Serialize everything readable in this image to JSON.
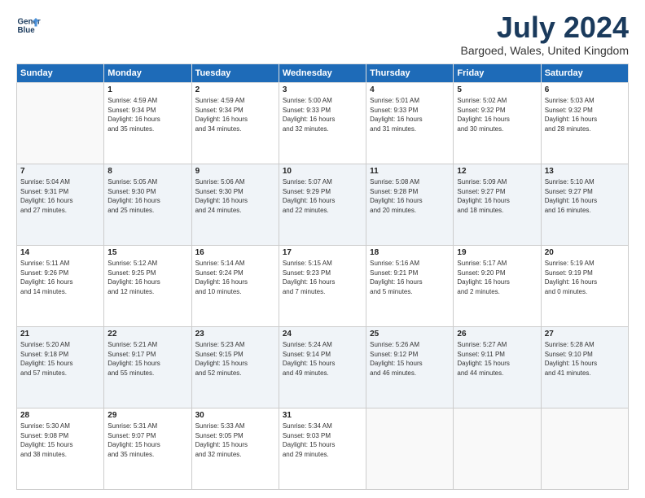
{
  "logo": {
    "line1": "General",
    "line2": "Blue"
  },
  "title": "July 2024",
  "location": "Bargoed, Wales, United Kingdom",
  "weekdays": [
    "Sunday",
    "Monday",
    "Tuesday",
    "Wednesday",
    "Thursday",
    "Friday",
    "Saturday"
  ],
  "weeks": [
    [
      {
        "day": "",
        "info": ""
      },
      {
        "day": "1",
        "info": "Sunrise: 4:59 AM\nSunset: 9:34 PM\nDaylight: 16 hours\nand 35 minutes."
      },
      {
        "day": "2",
        "info": "Sunrise: 4:59 AM\nSunset: 9:34 PM\nDaylight: 16 hours\nand 34 minutes."
      },
      {
        "day": "3",
        "info": "Sunrise: 5:00 AM\nSunset: 9:33 PM\nDaylight: 16 hours\nand 32 minutes."
      },
      {
        "day": "4",
        "info": "Sunrise: 5:01 AM\nSunset: 9:33 PM\nDaylight: 16 hours\nand 31 minutes."
      },
      {
        "day": "5",
        "info": "Sunrise: 5:02 AM\nSunset: 9:32 PM\nDaylight: 16 hours\nand 30 minutes."
      },
      {
        "day": "6",
        "info": "Sunrise: 5:03 AM\nSunset: 9:32 PM\nDaylight: 16 hours\nand 28 minutes."
      }
    ],
    [
      {
        "day": "7",
        "info": "Sunrise: 5:04 AM\nSunset: 9:31 PM\nDaylight: 16 hours\nand 27 minutes."
      },
      {
        "day": "8",
        "info": "Sunrise: 5:05 AM\nSunset: 9:30 PM\nDaylight: 16 hours\nand 25 minutes."
      },
      {
        "day": "9",
        "info": "Sunrise: 5:06 AM\nSunset: 9:30 PM\nDaylight: 16 hours\nand 24 minutes."
      },
      {
        "day": "10",
        "info": "Sunrise: 5:07 AM\nSunset: 9:29 PM\nDaylight: 16 hours\nand 22 minutes."
      },
      {
        "day": "11",
        "info": "Sunrise: 5:08 AM\nSunset: 9:28 PM\nDaylight: 16 hours\nand 20 minutes."
      },
      {
        "day": "12",
        "info": "Sunrise: 5:09 AM\nSunset: 9:27 PM\nDaylight: 16 hours\nand 18 minutes."
      },
      {
        "day": "13",
        "info": "Sunrise: 5:10 AM\nSunset: 9:27 PM\nDaylight: 16 hours\nand 16 minutes."
      }
    ],
    [
      {
        "day": "14",
        "info": "Sunrise: 5:11 AM\nSunset: 9:26 PM\nDaylight: 16 hours\nand 14 minutes."
      },
      {
        "day": "15",
        "info": "Sunrise: 5:12 AM\nSunset: 9:25 PM\nDaylight: 16 hours\nand 12 minutes."
      },
      {
        "day": "16",
        "info": "Sunrise: 5:14 AM\nSunset: 9:24 PM\nDaylight: 16 hours\nand 10 minutes."
      },
      {
        "day": "17",
        "info": "Sunrise: 5:15 AM\nSunset: 9:23 PM\nDaylight: 16 hours\nand 7 minutes."
      },
      {
        "day": "18",
        "info": "Sunrise: 5:16 AM\nSunset: 9:21 PM\nDaylight: 16 hours\nand 5 minutes."
      },
      {
        "day": "19",
        "info": "Sunrise: 5:17 AM\nSunset: 9:20 PM\nDaylight: 16 hours\nand 2 minutes."
      },
      {
        "day": "20",
        "info": "Sunrise: 5:19 AM\nSunset: 9:19 PM\nDaylight: 16 hours\nand 0 minutes."
      }
    ],
    [
      {
        "day": "21",
        "info": "Sunrise: 5:20 AM\nSunset: 9:18 PM\nDaylight: 15 hours\nand 57 minutes."
      },
      {
        "day": "22",
        "info": "Sunrise: 5:21 AM\nSunset: 9:17 PM\nDaylight: 15 hours\nand 55 minutes."
      },
      {
        "day": "23",
        "info": "Sunrise: 5:23 AM\nSunset: 9:15 PM\nDaylight: 15 hours\nand 52 minutes."
      },
      {
        "day": "24",
        "info": "Sunrise: 5:24 AM\nSunset: 9:14 PM\nDaylight: 15 hours\nand 49 minutes."
      },
      {
        "day": "25",
        "info": "Sunrise: 5:26 AM\nSunset: 9:12 PM\nDaylight: 15 hours\nand 46 minutes."
      },
      {
        "day": "26",
        "info": "Sunrise: 5:27 AM\nSunset: 9:11 PM\nDaylight: 15 hours\nand 44 minutes."
      },
      {
        "day": "27",
        "info": "Sunrise: 5:28 AM\nSunset: 9:10 PM\nDaylight: 15 hours\nand 41 minutes."
      }
    ],
    [
      {
        "day": "28",
        "info": "Sunrise: 5:30 AM\nSunset: 9:08 PM\nDaylight: 15 hours\nand 38 minutes."
      },
      {
        "day": "29",
        "info": "Sunrise: 5:31 AM\nSunset: 9:07 PM\nDaylight: 15 hours\nand 35 minutes."
      },
      {
        "day": "30",
        "info": "Sunrise: 5:33 AM\nSunset: 9:05 PM\nDaylight: 15 hours\nand 32 minutes."
      },
      {
        "day": "31",
        "info": "Sunrise: 5:34 AM\nSunset: 9:03 PM\nDaylight: 15 hours\nand 29 minutes."
      },
      {
        "day": "",
        "info": ""
      },
      {
        "day": "",
        "info": ""
      },
      {
        "day": "",
        "info": ""
      }
    ]
  ]
}
